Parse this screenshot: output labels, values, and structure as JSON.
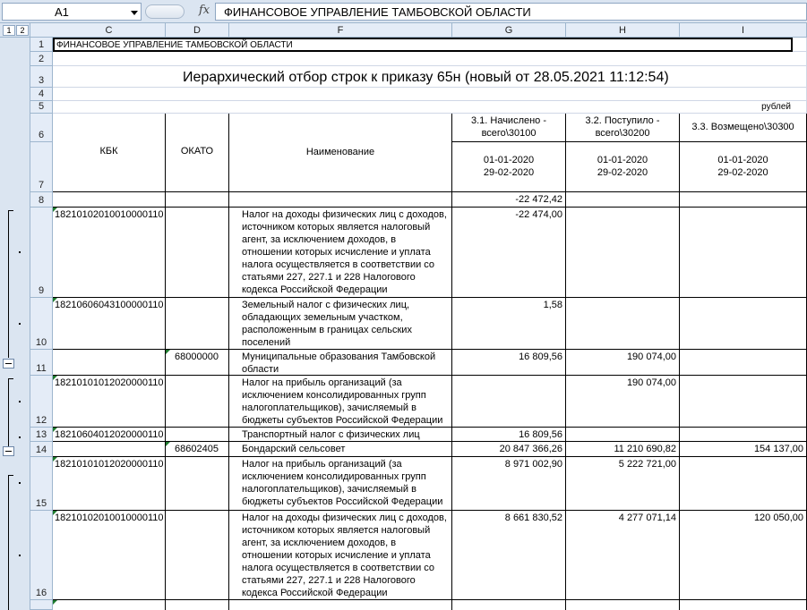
{
  "formula_bar": {
    "cell_ref": "A1",
    "fx_label": "fx",
    "content": "ФИНАНСОВОЕ УПРАВЛЕНИЕ ТАМБОВСКОЙ ОБЛАСТИ"
  },
  "outline_levels": [
    "1",
    "2"
  ],
  "columns": [
    "C",
    "D",
    "F",
    "G",
    "H",
    "I"
  ],
  "row_numbers": [
    "1",
    "2",
    "3",
    "4",
    "5",
    "6",
    "7",
    "8",
    "9",
    "10",
    "11",
    "12",
    "13",
    "14",
    "15",
    "16"
  ],
  "sheet": {
    "org_name": "ФИНАНСОВОЕ УПРАВЛЕНИЕ ТАМБОВСКОЙ ОБЛАСТИ",
    "title": "Иерархический отбор строк к приказу 65н (новый от 28.05.2021 11:12:54)",
    "units": "рублей",
    "headers": {
      "kbk": "КБК",
      "okato": "ОКАТО",
      "name": "Наименование",
      "g": "3.1. Начислено - всего\\30100",
      "h": "3.2. Поступило - всего\\30200",
      "i": "3.3. Возмещено\\30300",
      "period_start": "01-01-2020",
      "period_end": "29-02-2020"
    },
    "rows": [
      {
        "kbk": "",
        "okato": "",
        "name": "",
        "g": "-22 472,42",
        "h": "",
        "i": ""
      },
      {
        "kbk": "18210102010010000110",
        "okato": "",
        "name": "Налог на доходы физических лиц с доходов, источником которых является налоговый агент, за исключением доходов, в отношении которых исчисление и уплата налога осуществляется в соответствии со статьями 227, 227.1 и 228 Налогового кодекса Российской Федерации",
        "g": "-22 474,00",
        "h": "",
        "i": ""
      },
      {
        "kbk": "18210606043100000110",
        "okato": "",
        "name": "Земельный налог с физических лиц, обладающих земельным участком, расположенным в границах сельских поселений",
        "g": "1,58",
        "h": "",
        "i": ""
      },
      {
        "kbk": "",
        "okato": "68000000",
        "name": "Муниципальные образования Тамбовской области",
        "g": "16 809,56",
        "h": "190 074,00",
        "i": ""
      },
      {
        "kbk": "18210101012020000110",
        "okato": "",
        "name": "Налог на прибыль организаций (за исключением консолидированных групп налогоплательщиков), зачисляемый в бюджеты субъектов Российской Федерации",
        "g": "",
        "h": "190 074,00",
        "i": ""
      },
      {
        "kbk": "18210604012020000110",
        "okato": "",
        "name": "Транспортный налог с физических лиц",
        "g": "16 809,56",
        "h": "",
        "i": ""
      },
      {
        "kbk": "",
        "okato": "68602405",
        "name": "Бондарский сельсовет",
        "g": "20 847 366,26",
        "h": "11 210 690,82",
        "i": "154 137,00"
      },
      {
        "kbk": "18210101012020000110",
        "okato": "",
        "name": "Налог на прибыль организаций (за исключением консолидированных групп налогоплательщиков), зачисляемый в бюджеты субъектов Российской Федерации",
        "g": "8 971 002,90",
        "h": "5 222 721,00",
        "i": ""
      },
      {
        "kbk": "18210102010010000110",
        "okato": "",
        "name": "Налог на доходы физических лиц с доходов, источником которых является налоговый агент, за исключением доходов, в отношении которых исчисление и уплата налога осуществляется в соответствии со статьями 227, 227.1 и 228 Налогового кодекса Российской Федерации",
        "g": "8 661 830,52",
        "h": "4 277 071,14",
        "i": "120 050,00"
      }
    ]
  }
}
